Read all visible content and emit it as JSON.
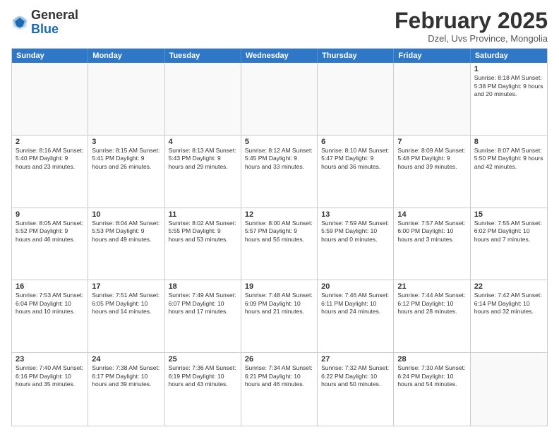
{
  "header": {
    "logo_general": "General",
    "logo_blue": "Blue",
    "main_title": "February 2025",
    "subtitle": "Dzel, Uvs Province, Mongolia"
  },
  "calendar": {
    "days_of_week": [
      "Sunday",
      "Monday",
      "Tuesday",
      "Wednesday",
      "Thursday",
      "Friday",
      "Saturday"
    ],
    "rows": [
      [
        {
          "day": "",
          "text": ""
        },
        {
          "day": "",
          "text": ""
        },
        {
          "day": "",
          "text": ""
        },
        {
          "day": "",
          "text": ""
        },
        {
          "day": "",
          "text": ""
        },
        {
          "day": "",
          "text": ""
        },
        {
          "day": "1",
          "text": "Sunrise: 8:18 AM\nSunset: 5:38 PM\nDaylight: 9 hours and 20 minutes."
        }
      ],
      [
        {
          "day": "2",
          "text": "Sunrise: 8:16 AM\nSunset: 5:40 PM\nDaylight: 9 hours and 23 minutes."
        },
        {
          "day": "3",
          "text": "Sunrise: 8:15 AM\nSunset: 5:41 PM\nDaylight: 9 hours and 26 minutes."
        },
        {
          "day": "4",
          "text": "Sunrise: 8:13 AM\nSunset: 5:43 PM\nDaylight: 9 hours and 29 minutes."
        },
        {
          "day": "5",
          "text": "Sunrise: 8:12 AM\nSunset: 5:45 PM\nDaylight: 9 hours and 33 minutes."
        },
        {
          "day": "6",
          "text": "Sunrise: 8:10 AM\nSunset: 5:47 PM\nDaylight: 9 hours and 36 minutes."
        },
        {
          "day": "7",
          "text": "Sunrise: 8:09 AM\nSunset: 5:48 PM\nDaylight: 9 hours and 39 minutes."
        },
        {
          "day": "8",
          "text": "Sunrise: 8:07 AM\nSunset: 5:50 PM\nDaylight: 9 hours and 42 minutes."
        }
      ],
      [
        {
          "day": "9",
          "text": "Sunrise: 8:05 AM\nSunset: 5:52 PM\nDaylight: 9 hours and 46 minutes."
        },
        {
          "day": "10",
          "text": "Sunrise: 8:04 AM\nSunset: 5:53 PM\nDaylight: 9 hours and 49 minutes."
        },
        {
          "day": "11",
          "text": "Sunrise: 8:02 AM\nSunset: 5:55 PM\nDaylight: 9 hours and 53 minutes."
        },
        {
          "day": "12",
          "text": "Sunrise: 8:00 AM\nSunset: 5:57 PM\nDaylight: 9 hours and 56 minutes."
        },
        {
          "day": "13",
          "text": "Sunrise: 7:59 AM\nSunset: 5:59 PM\nDaylight: 10 hours and 0 minutes."
        },
        {
          "day": "14",
          "text": "Sunrise: 7:57 AM\nSunset: 6:00 PM\nDaylight: 10 hours and 3 minutes."
        },
        {
          "day": "15",
          "text": "Sunrise: 7:55 AM\nSunset: 6:02 PM\nDaylight: 10 hours and 7 minutes."
        }
      ],
      [
        {
          "day": "16",
          "text": "Sunrise: 7:53 AM\nSunset: 6:04 PM\nDaylight: 10 hours and 10 minutes."
        },
        {
          "day": "17",
          "text": "Sunrise: 7:51 AM\nSunset: 6:05 PM\nDaylight: 10 hours and 14 minutes."
        },
        {
          "day": "18",
          "text": "Sunrise: 7:49 AM\nSunset: 6:07 PM\nDaylight: 10 hours and 17 minutes."
        },
        {
          "day": "19",
          "text": "Sunrise: 7:48 AM\nSunset: 6:09 PM\nDaylight: 10 hours and 21 minutes."
        },
        {
          "day": "20",
          "text": "Sunrise: 7:46 AM\nSunset: 6:11 PM\nDaylight: 10 hours and 24 minutes."
        },
        {
          "day": "21",
          "text": "Sunrise: 7:44 AM\nSunset: 6:12 PM\nDaylight: 10 hours and 28 minutes."
        },
        {
          "day": "22",
          "text": "Sunrise: 7:42 AM\nSunset: 6:14 PM\nDaylight: 10 hours and 32 minutes."
        }
      ],
      [
        {
          "day": "23",
          "text": "Sunrise: 7:40 AM\nSunset: 6:16 PM\nDaylight: 10 hours and 35 minutes."
        },
        {
          "day": "24",
          "text": "Sunrise: 7:38 AM\nSunset: 6:17 PM\nDaylight: 10 hours and 39 minutes."
        },
        {
          "day": "25",
          "text": "Sunrise: 7:36 AM\nSunset: 6:19 PM\nDaylight: 10 hours and 43 minutes."
        },
        {
          "day": "26",
          "text": "Sunrise: 7:34 AM\nSunset: 6:21 PM\nDaylight: 10 hours and 46 minutes."
        },
        {
          "day": "27",
          "text": "Sunrise: 7:32 AM\nSunset: 6:22 PM\nDaylight: 10 hours and 50 minutes."
        },
        {
          "day": "28",
          "text": "Sunrise: 7:30 AM\nSunset: 6:24 PM\nDaylight: 10 hours and 54 minutes."
        },
        {
          "day": "",
          "text": ""
        }
      ]
    ]
  }
}
